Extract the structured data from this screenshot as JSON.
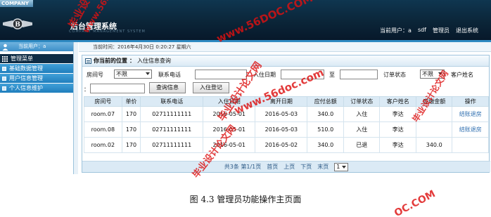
{
  "header": {
    "company": "COMPANY",
    "title": "后台管理系统",
    "subtitle": "COMPANY MANAGEMENT SYSTEM",
    "current_user_label": "当前用户：",
    "current_user": "a",
    "username": "sdf",
    "role": "管理员",
    "logout": "退出系统"
  },
  "sidebar": {
    "user_label": "当前用户：a",
    "menu_title": "管理菜单",
    "items": [
      {
        "label": "基础数据管理"
      },
      {
        "label": "用户信息管理"
      },
      {
        "label": "个人信息维护"
      }
    ]
  },
  "datebar": {
    "text": "当前时间：2016年4月30日 0:20:27 星期六"
  },
  "breadcrumb": {
    "position_label": "你当前的位置",
    "separator": "：",
    "page": "入住信息查询"
  },
  "filters": {
    "room_label": "房间号",
    "room_value": "不限",
    "phone_label": "联系电话",
    "checkin_label": "入住日期",
    "to_label": "至",
    "status_label": "订单状态",
    "status_value": "不限",
    "customer_label": "客户姓名",
    "query_button": "查询信息",
    "register_button": "入住登记"
  },
  "table": {
    "headers": [
      "房间号",
      "单价",
      "联系电话",
      "入住日期",
      "离开日期",
      "应付总额",
      "订单状态",
      "客户姓名",
      "应缴金额",
      "操作"
    ],
    "rows": [
      {
        "room": "room.07",
        "price": "170",
        "phone": "02711111111",
        "checkin": "2016-05-01",
        "checkout": "2016-05-03",
        "total": "340.0",
        "status": "入住",
        "customer": "李达",
        "due": "",
        "action": "结账退房"
      },
      {
        "room": "room.08",
        "price": "170",
        "phone": "02711111111",
        "checkin": "2016-05-01",
        "checkout": "2016-05-03",
        "total": "510.0",
        "status": "入住",
        "customer": "李达",
        "due": "",
        "action": "结账退房"
      },
      {
        "room": "room.02",
        "price": "170",
        "phone": "02711111111",
        "checkin": "2016-05-01",
        "checkout": "2016-05-02",
        "total": "340.0",
        "status": "已退",
        "customer": "李达",
        "due": "340.0",
        "action": ""
      }
    ]
  },
  "pager": {
    "summary": "共3条 第1/1页",
    "first": "首页",
    "prev": "上页",
    "next": "下页",
    "last": "末页",
    "page_value": "1"
  },
  "caption": "图 4.3 管理员功能操作主页面",
  "watermarks": {
    "wm1": "毕业设计论文网",
    "wm2": "www.56DOC.com",
    "wm3": "毕业设计论文网",
    "wm4": "www.56doc.com",
    "wm5": "毕业设计论文网",
    "wm6": "www.56DOC.COM",
    "wm7": "毕业设计论文网",
    "wm8": "OC.COM"
  }
}
